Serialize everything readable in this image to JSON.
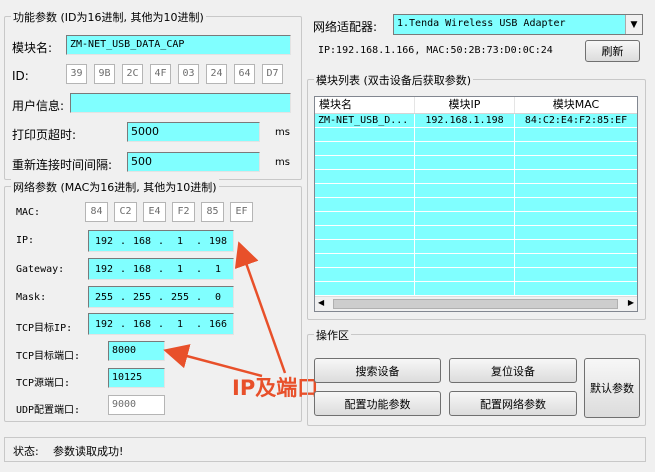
{
  "func_group": {
    "title": "功能参数 (ID为16进制, 其他为10进制)",
    "module_name_label": "模块名:",
    "module_name": "ZM-NET_USB_DATA_CAP",
    "id_label": "ID:",
    "id_bytes": [
      "39",
      "9B",
      "2C",
      "4F",
      "03",
      "24",
      "64",
      "D7"
    ],
    "user_info_label": "用户信息:",
    "user_info": "",
    "print_timeout_label": "打印页超时:",
    "print_timeout": "5000",
    "print_timeout_unit": "ms",
    "reconnect_label": "重新连接时间间隔:",
    "reconnect": "500",
    "reconnect_unit": "ms"
  },
  "net_group": {
    "title": "网络参数 (MAC为16进制, 其他为10进制)",
    "mac_label": "MAC:",
    "mac_bytes": [
      "84",
      "C2",
      "E4",
      "F2",
      "85",
      "EF"
    ],
    "ip_label": "IP:",
    "ip": [
      "192",
      "168",
      "1",
      "198"
    ],
    "gateway_label": "Gateway:",
    "gateway": [
      "192",
      "168",
      "1",
      "1"
    ],
    "mask_label": "Mask:",
    "mask": [
      "255",
      "255",
      "255",
      "0"
    ],
    "tcp_target_ip_label": "TCP目标IP:",
    "tcp_target_ip": [
      "192",
      "168",
      "1",
      "166"
    ],
    "tcp_target_port_label": "TCP目标端口:",
    "tcp_target_port": "8000",
    "tcp_src_port_label": "TCP源端口:",
    "tcp_src_port": "10125",
    "udp_port_label": "UDP配置端口:",
    "udp_port": "9000"
  },
  "adapter": {
    "label": "网络适配器:",
    "selected": "1.Tenda Wireless USB Adapter",
    "info": "IP:192.168.1.166, MAC:50:2B:73:D0:0C:24",
    "refresh_label": "刷新"
  },
  "module_list": {
    "title": "模块列表 (双击设备后获取参数)",
    "columns": [
      "模块名",
      "模块IP",
      "模块MAC"
    ],
    "rows": [
      [
        "ZM-NET_USB_D...",
        "192.168.1.198",
        "84:C2:E4:F2:85:EF"
      ]
    ],
    "empty_rows": 12
  },
  "ops": {
    "title": "操作区",
    "search_label": "搜索设备",
    "reset_label": "复位设备",
    "default_label": "默认参数",
    "config_func_label": "配置功能参数",
    "config_net_label": "配置网络参数"
  },
  "annotation": {
    "text": "IP及端口",
    "color": "#e8502a"
  },
  "status": {
    "label": "状态:",
    "text": "参数读取成功!"
  }
}
